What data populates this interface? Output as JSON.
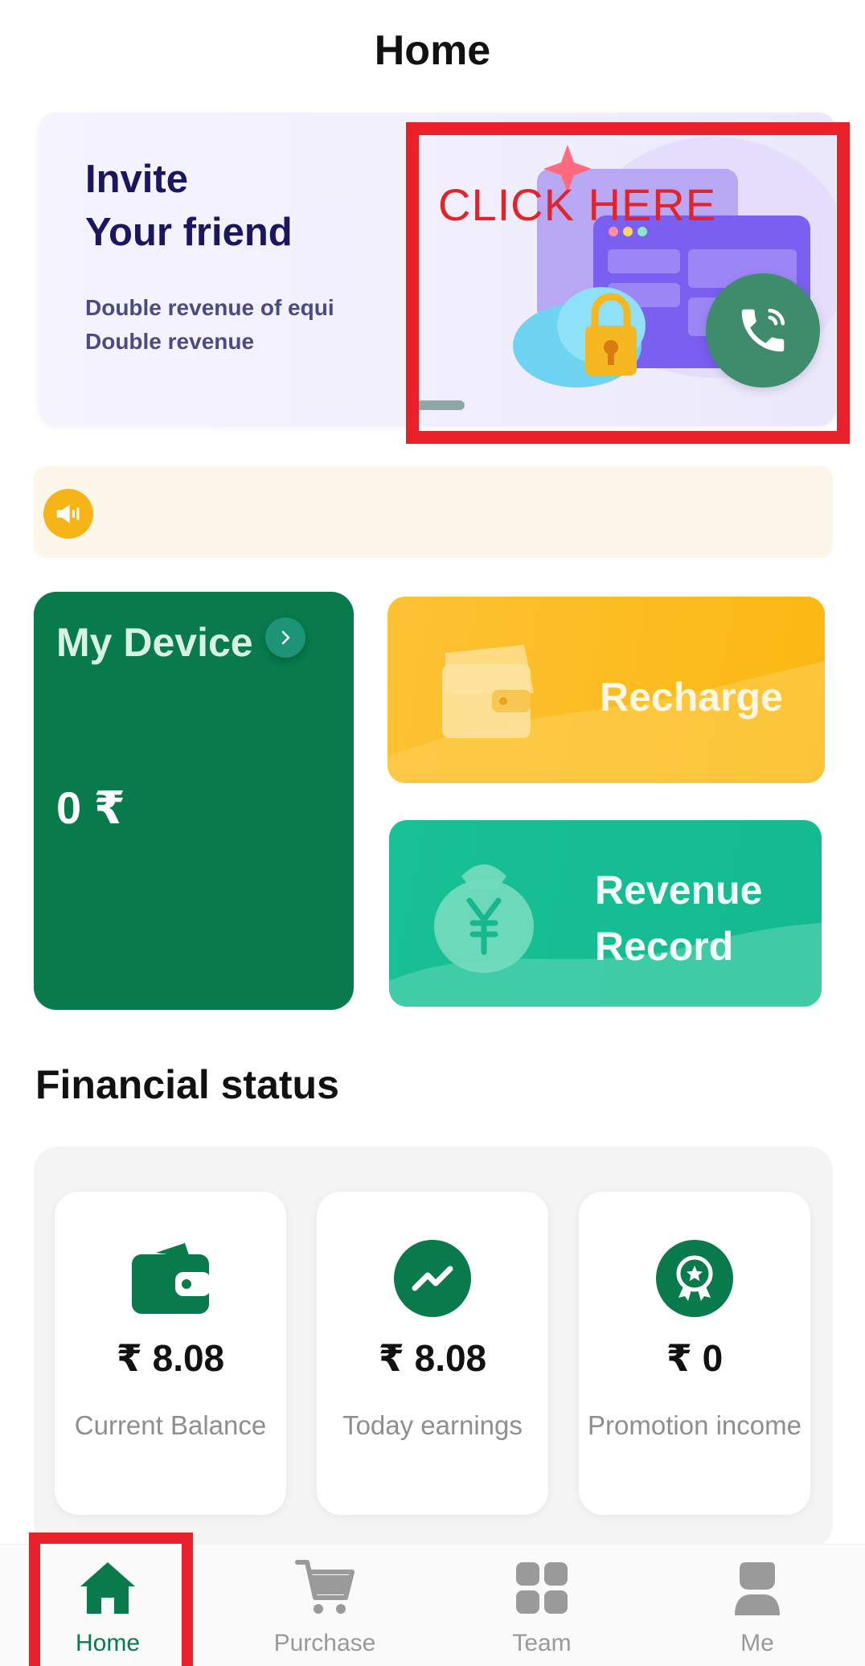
{
  "header": {
    "title": "Home"
  },
  "banner": {
    "title": "Invite\nYour friend",
    "subtitle": "Double revenue of equi\nDouble revenue",
    "overlay_text": "CLICK HERE"
  },
  "device": {
    "title": "My Device",
    "value": "0 ₹"
  },
  "actions": {
    "recharge": "Recharge",
    "revenue": "Revenue\nRecord"
  },
  "financial": {
    "title": "Financial status",
    "cards": [
      {
        "value": "₹ 8.08",
        "label": "Current Balance",
        "icon": "wallet-icon"
      },
      {
        "value": "₹ 8.08",
        "label": "Today earnings",
        "icon": "trend-icon"
      },
      {
        "value": "₹ 0",
        "label": "Promotion income",
        "icon": "award-icon"
      }
    ]
  },
  "nav": {
    "items": [
      {
        "label": "Home",
        "icon": "home-icon",
        "active": true
      },
      {
        "label": "Purchase",
        "icon": "cart-icon",
        "active": false
      },
      {
        "label": "Team",
        "icon": "grid-icon",
        "active": false
      },
      {
        "label": "Me",
        "icon": "user-icon",
        "active": false
      }
    ]
  },
  "colors": {
    "brand_green": "#087a4b",
    "recharge_yellow": "#fbb812",
    "revenue_teal": "#14b98f",
    "highlight_red": "#e8202a"
  }
}
